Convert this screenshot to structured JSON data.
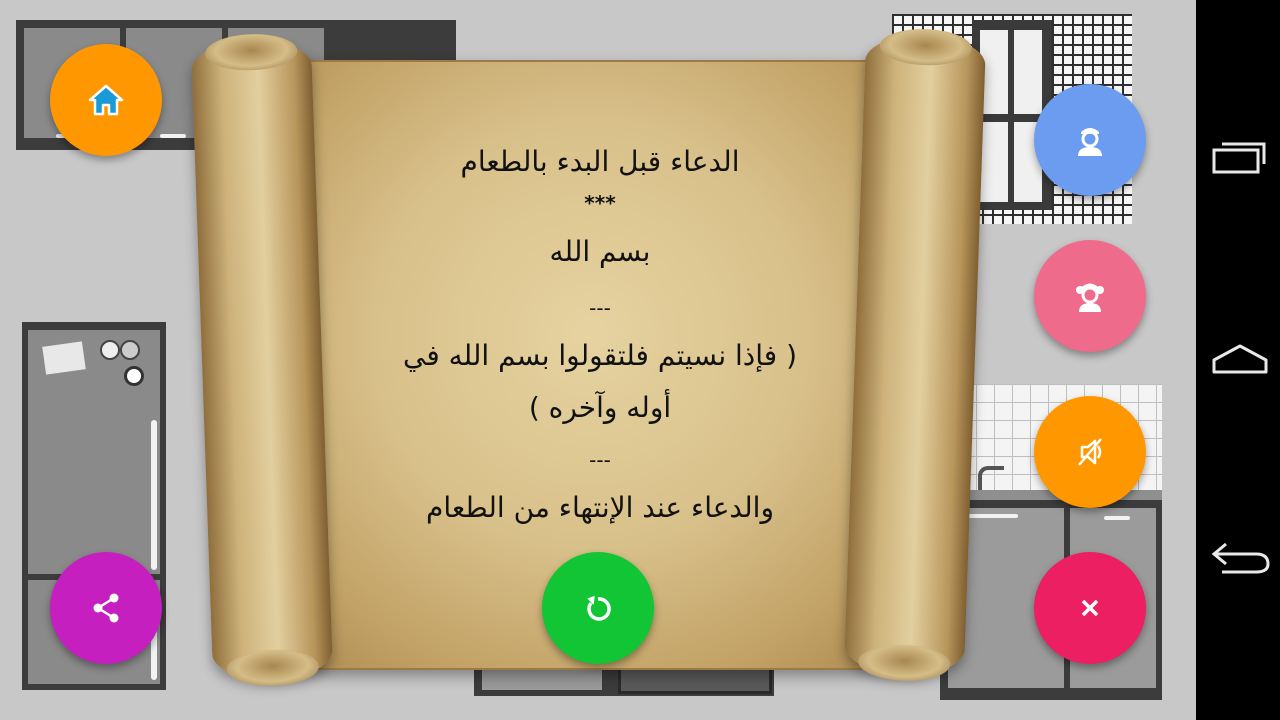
{
  "scroll": {
    "title": "الدعاء قبل البدء بالطعام",
    "stars": "***",
    "line1": "بسم الله",
    "sep1": "---",
    "line2": "( فإذا نسيتم فلتقولوا بسم الله في",
    "line3": "أوله وآخره )",
    "sep2": "---",
    "line4": "والدعاء عند الإنتهاء من الطعام"
  },
  "buttons": {
    "home": {
      "icon": "home-icon",
      "color": "#ff9800"
    },
    "boy": {
      "icon": "boy-icon",
      "color": "#6c9cf0"
    },
    "girl": {
      "icon": "girl-icon",
      "color": "#ee6b8c"
    },
    "mute": {
      "icon": "sound-off-icon",
      "color": "#ff9800"
    },
    "share": {
      "icon": "share-icon",
      "color": "#c51fbf"
    },
    "replay": {
      "icon": "replay-icon",
      "color": "#12c534"
    },
    "close": {
      "icon": "close-icon",
      "color": "#ec1f63"
    }
  },
  "navbar": {
    "recents": "recent-apps-icon",
    "home": "home-outline-icon",
    "back": "back-arrow-icon"
  }
}
